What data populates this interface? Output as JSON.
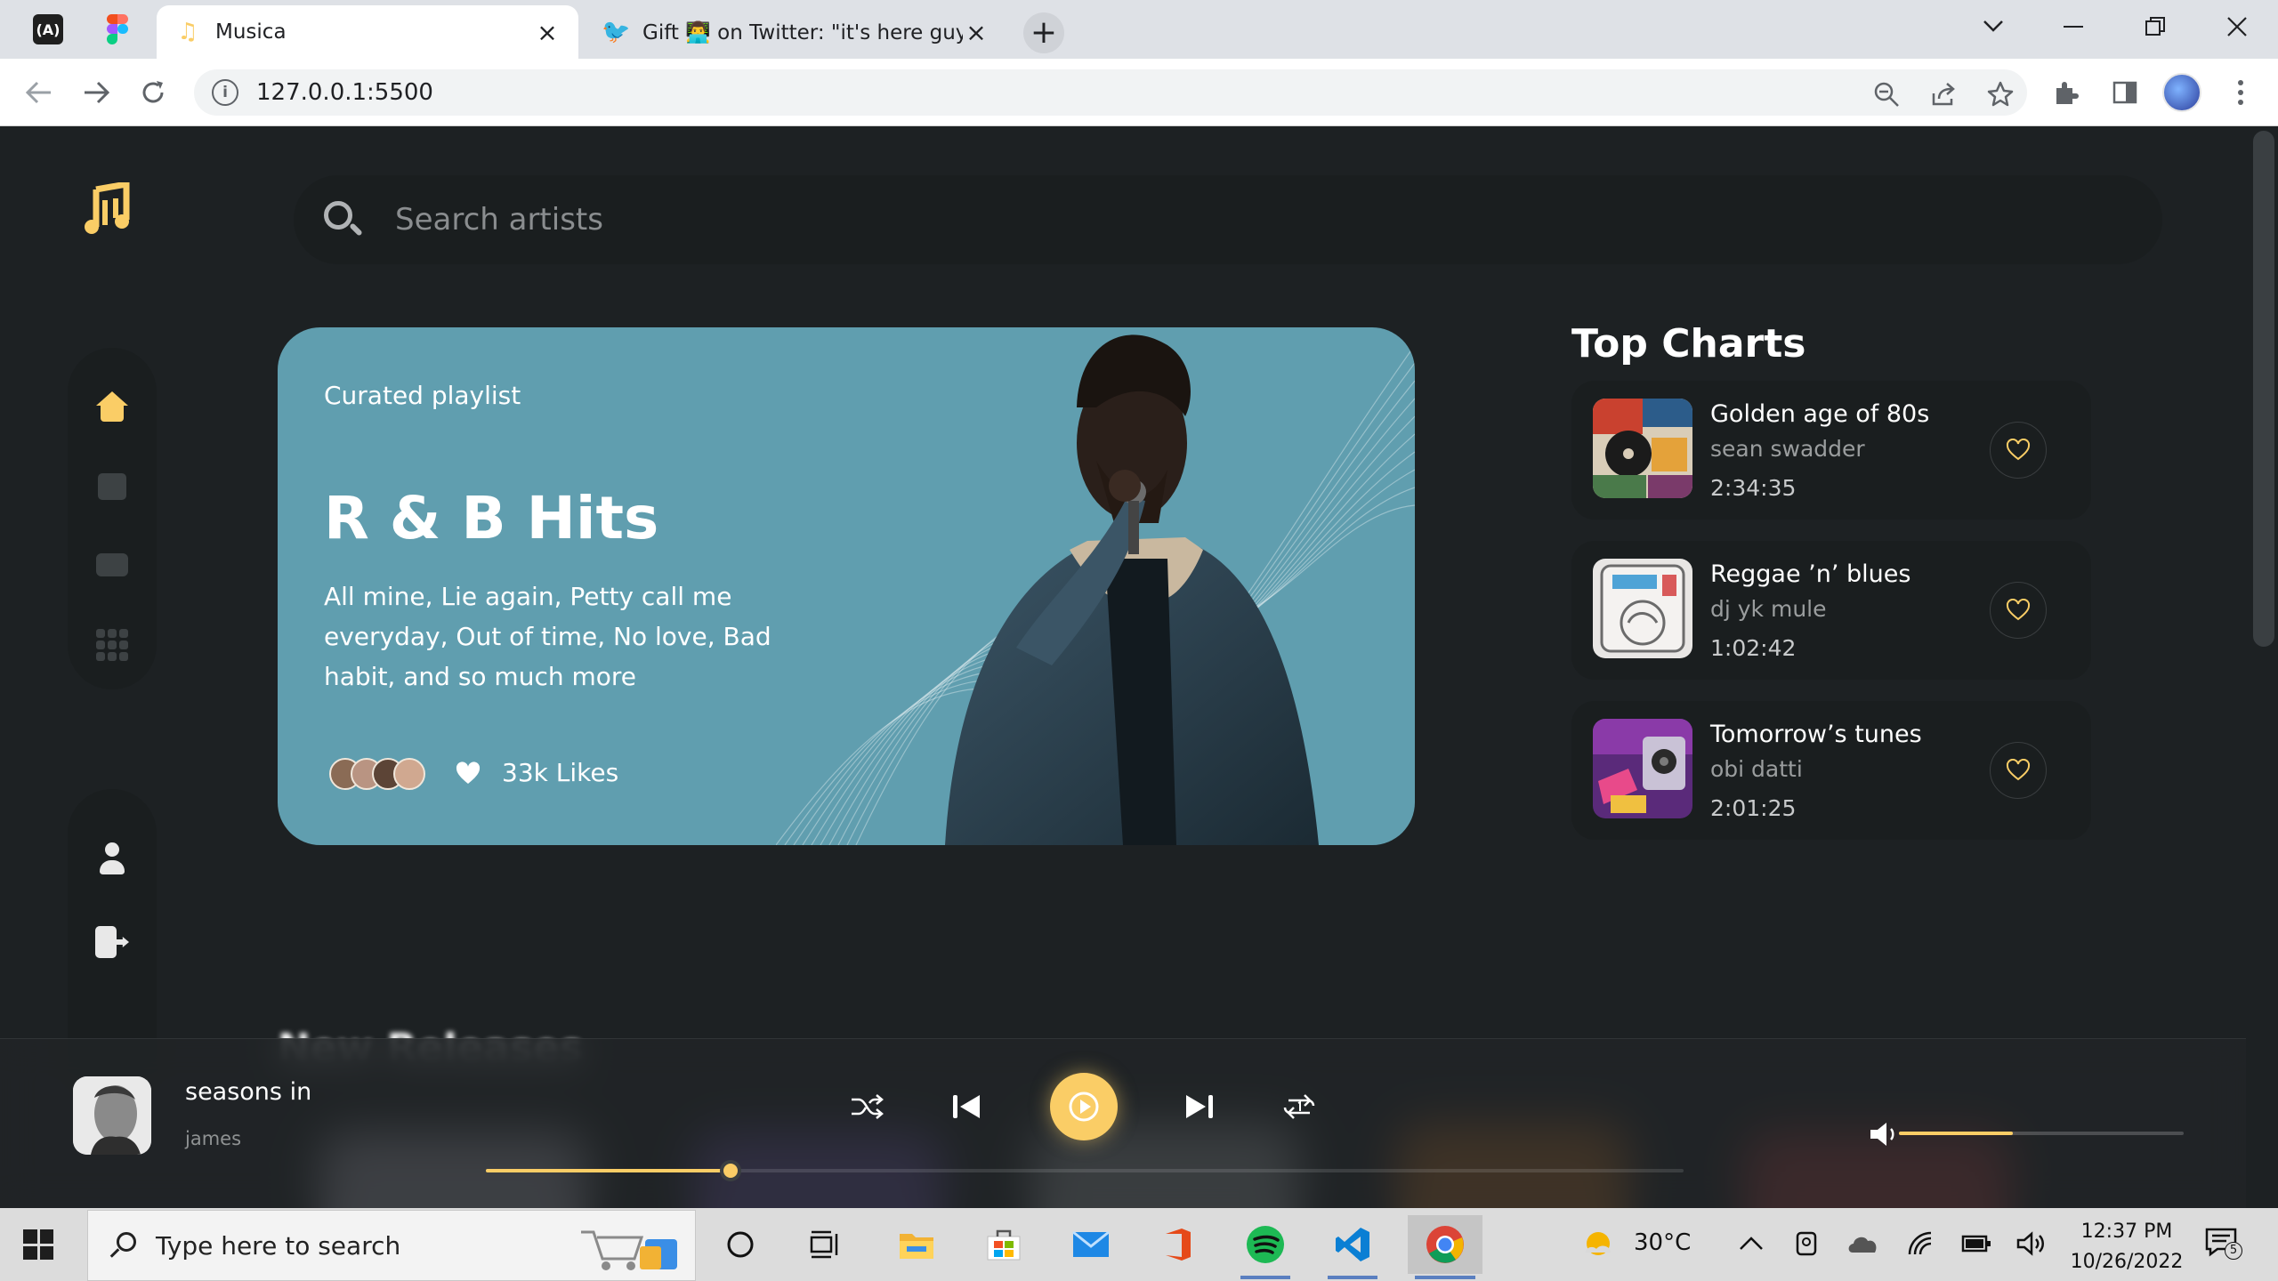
{
  "browser": {
    "tabs": [
      {
        "title": "Musica",
        "icon": "music-note-icon",
        "active": true
      },
      {
        "title": "Gift 👨‍💻 on Twitter: \"it's here guys",
        "icon": "twitter-bird-icon",
        "active": false
      }
    ],
    "url": "127.0.0.1:5500"
  },
  "app": {
    "search_placeholder": "Search artists",
    "hero": {
      "eyebrow": "Curated playlist",
      "title": "R & B Hits",
      "description": "All mine, Lie again, Petty call me everyday, Out of time, No love, Bad habit, and so much more",
      "likes": "33k Likes"
    },
    "top_charts": {
      "title": "Top Charts",
      "items": [
        {
          "name": "Golden age of 80s",
          "artist": "sean swadder",
          "duration": "2:34:35"
        },
        {
          "name": "Reggae ’n’ blues",
          "artist": "dj yk mule",
          "duration": "1:02:42"
        },
        {
          "name": "Tomorrow’s tunes",
          "artist": "obi datti",
          "duration": "2:01:25"
        }
      ]
    },
    "next_section_title": "New Releases",
    "player": {
      "song": "seasons in",
      "artist": "james",
      "progress": 0.204,
      "volume": 0.4
    },
    "colors": {
      "accent": "#facd66",
      "background": "#1d2123",
      "hero": "#609eaf"
    }
  },
  "taskbar": {
    "search_placeholder": "Type here to search",
    "weather": "30°C",
    "time": "12:37 PM",
    "date": "10/26/2022",
    "notifications": "5"
  }
}
